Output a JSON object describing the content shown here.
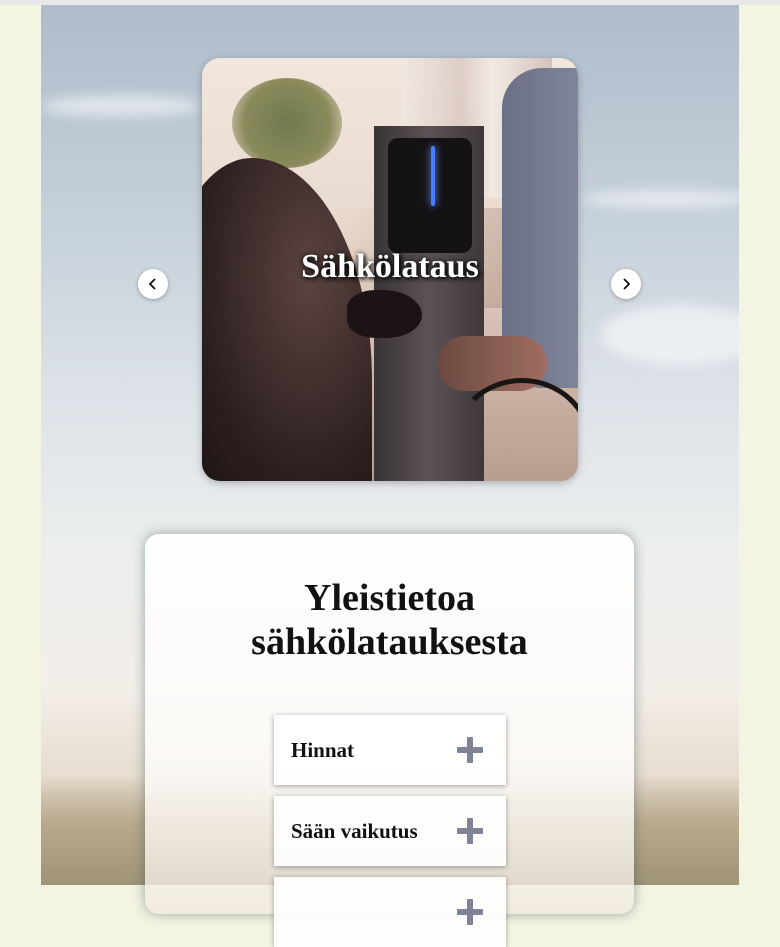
{
  "carousel": {
    "slide_title": "Sähkölataus",
    "prev_icon": "chevron-left-icon",
    "next_icon": "chevron-right-icon"
  },
  "info": {
    "title_line1": "Yleistietoa",
    "title_line2": "sähkölatauksesta",
    "items": [
      {
        "label": "Hinnat",
        "icon": "plus-icon"
      },
      {
        "label": "Sään vaikutus",
        "icon": "plus-icon"
      },
      {
        "label": "",
        "icon": "plus-icon"
      }
    ]
  },
  "colors": {
    "page_side": "#f4f4e2",
    "icon_gray": "#7c8496",
    "text": "#111111"
  }
}
